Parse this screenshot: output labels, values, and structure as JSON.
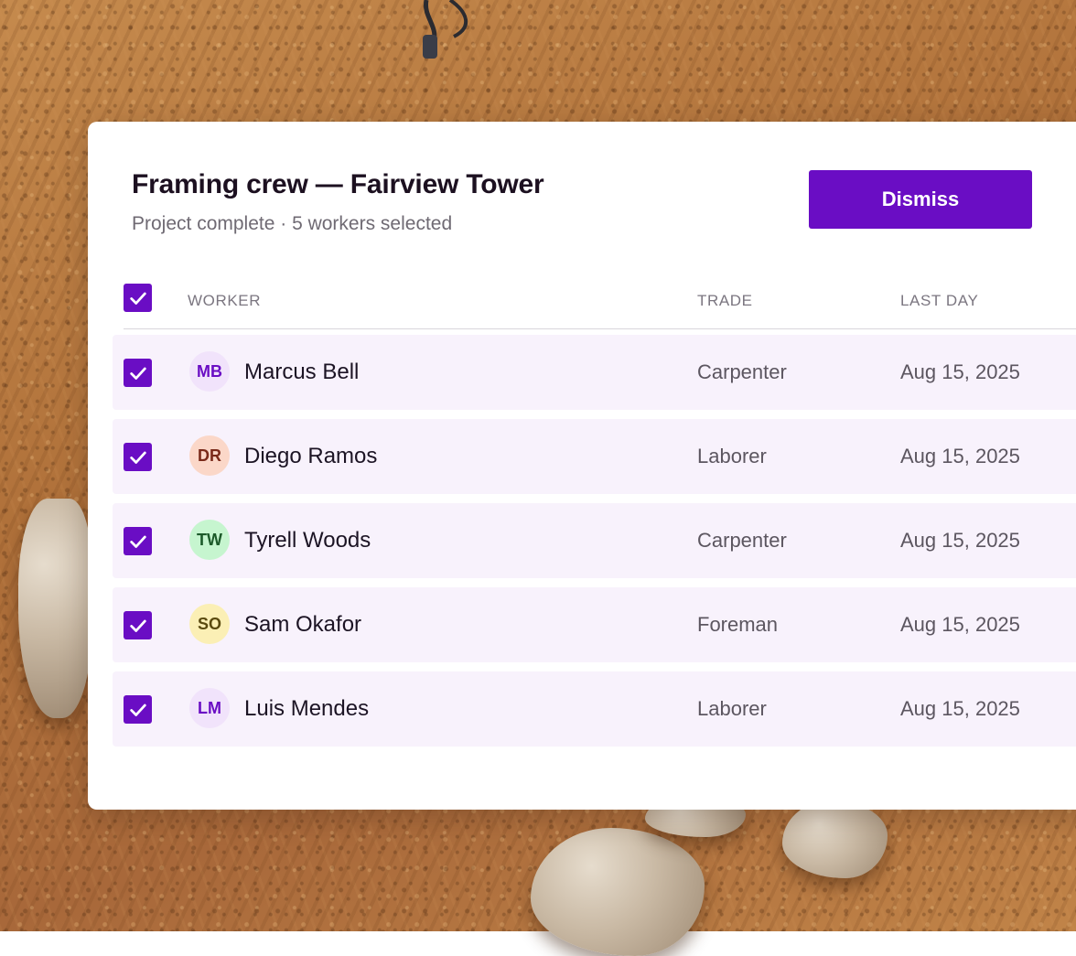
{
  "panel": {
    "title": "Framing crew — Fairview Tower",
    "subtitle": "Project complete · 5 workers selected",
    "dismiss_label": "Dismiss"
  },
  "table": {
    "columns": {
      "worker": "WORKER",
      "trade": "TRADE",
      "last_day": "LAST DAY"
    },
    "select_all_checked": true,
    "rows": [
      {
        "initials": "MB",
        "name": "Marcus Bell",
        "trade": "Carpenter",
        "last_day": "Aug 15, 2025",
        "checked": true,
        "avatar_bg": "#f1e3fb",
        "avatar_fg": "#6a0dc4"
      },
      {
        "initials": "DR",
        "name": "Diego Ramos",
        "trade": "Laborer",
        "last_day": "Aug 15, 2025",
        "checked": true,
        "avatar_bg": "#fbd7c8",
        "avatar_fg": "#7a2a1a"
      },
      {
        "initials": "TW",
        "name": "Tyrell Woods",
        "trade": "Carpenter",
        "last_day": "Aug 15, 2025",
        "checked": true,
        "avatar_bg": "#c6f5cf",
        "avatar_fg": "#1d5a2a"
      },
      {
        "initials": "SO",
        "name": "Sam Okafor",
        "trade": "Foreman",
        "last_day": "Aug 15, 2025",
        "checked": true,
        "avatar_bg": "#fbefb5",
        "avatar_fg": "#5a4a10"
      },
      {
        "initials": "LM",
        "name": "Luis Mendes",
        "trade": "Laborer",
        "last_day": "Aug 15, 2025",
        "checked": true,
        "avatar_bg": "#f1e3fb",
        "avatar_fg": "#6a0dc4"
      }
    ]
  },
  "colors": {
    "accent": "#6a0dc4",
    "row_bg": "#f8f2fc"
  }
}
